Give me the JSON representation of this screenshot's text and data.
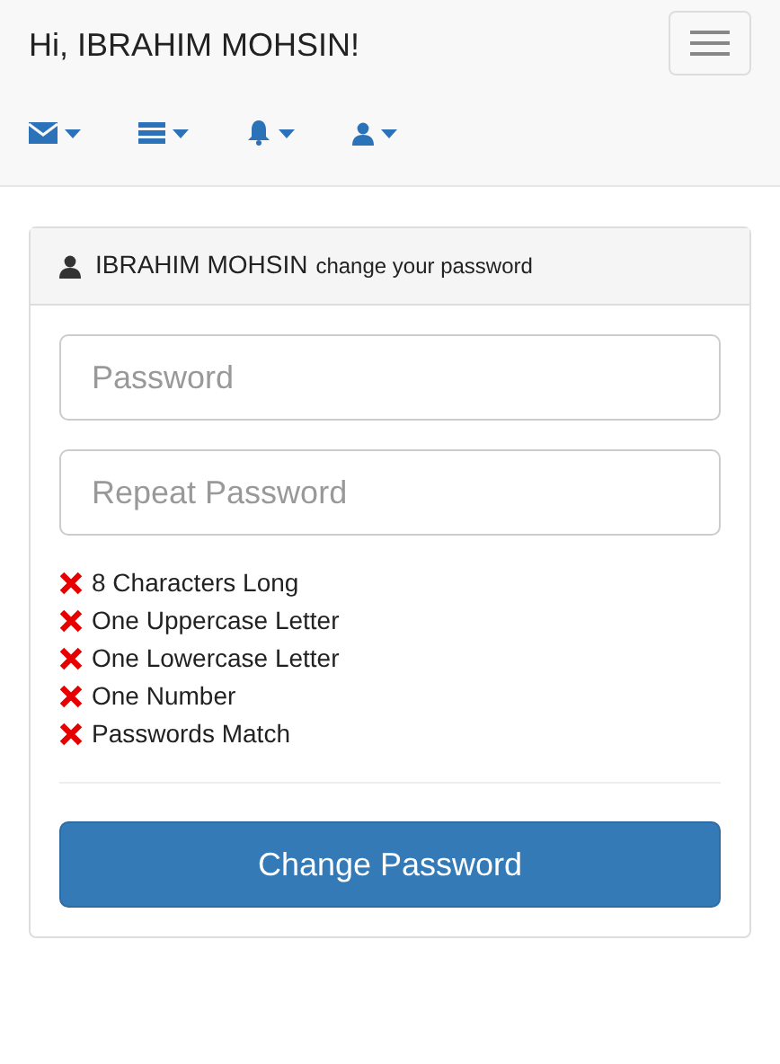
{
  "navbar": {
    "brand": "Hi, IBRAHIM MOHSIN!"
  },
  "card": {
    "header_name": "IBRAHIM MOHSIN",
    "header_note": "change your password",
    "fields": [
      {
        "placeholder": "Password"
      },
      {
        "placeholder": "Repeat Password"
      }
    ],
    "requirements": [
      {
        "label": "8 Characters Long",
        "met": false
      },
      {
        "label": "One Uppercase Letter",
        "met": false
      },
      {
        "label": "One Lowercase Letter",
        "met": false
      },
      {
        "label": "One Number",
        "met": false
      },
      {
        "label": "Passwords Match",
        "met": false
      }
    ],
    "button": "Change Password"
  }
}
